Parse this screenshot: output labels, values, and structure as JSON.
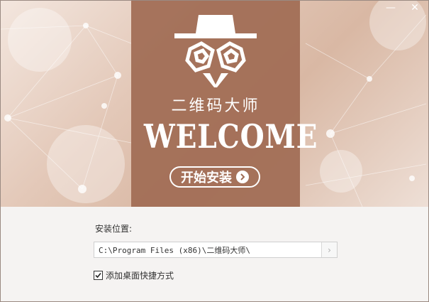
{
  "window": {
    "minimize_glyph": "—",
    "close_glyph": "✕"
  },
  "banner": {
    "app_name": "二维码大师",
    "welcome": "WELCOME",
    "start_button_label": "开始安装"
  },
  "install": {
    "path_label": "安装位置:",
    "path_value": "C:\\Program Files (x86)\\二维码大师\\",
    "browse_glyph": "›",
    "shortcut_label": "添加桌面快捷方式",
    "shortcut_checked": true
  },
  "colors": {
    "accent": "#a06c54",
    "banner_light": "#f3e6de"
  },
  "icons": [
    "hat-logo-icon",
    "arrow-right-icon",
    "check-icon"
  ]
}
